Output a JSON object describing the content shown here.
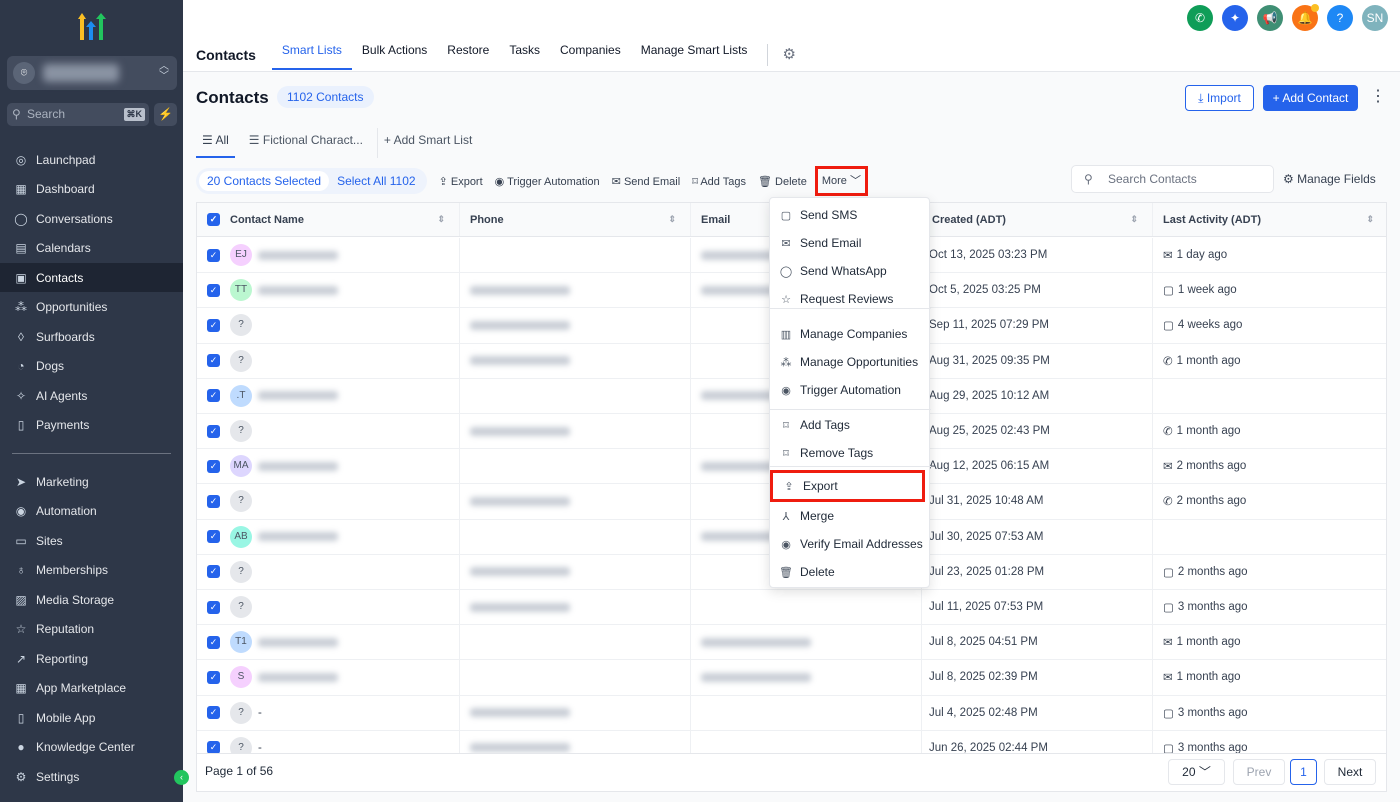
{
  "sidebar": {
    "search_placeholder": "Search",
    "shortcut": "⌘K",
    "items": [
      {
        "label": "Launchpad",
        "icon": "rocket-icon",
        "g": "◎"
      },
      {
        "label": "Dashboard",
        "icon": "dashboard-icon",
        "g": "▦"
      },
      {
        "label": "Conversations",
        "icon": "chat-icon",
        "g": "◯"
      },
      {
        "label": "Calendars",
        "icon": "calendar-icon",
        "g": "▤"
      },
      {
        "label": "Contacts",
        "icon": "contacts-icon",
        "g": "▣"
      },
      {
        "label": "Opportunities",
        "icon": "opportunities-icon",
        "g": "⁂"
      },
      {
        "label": "Surfboards",
        "icon": "surfboard-icon",
        "g": "◊"
      },
      {
        "label": "Dogs",
        "icon": "dog-icon",
        "g": "◔"
      },
      {
        "label": "AI Agents",
        "icon": "sparkle-icon",
        "g": "✧"
      },
      {
        "label": "Payments",
        "icon": "receipt-icon",
        "g": "▯"
      }
    ],
    "items2": [
      {
        "label": "Marketing",
        "icon": "send-icon",
        "g": "➤"
      },
      {
        "label": "Automation",
        "icon": "automation-icon",
        "g": "◉"
      },
      {
        "label": "Sites",
        "icon": "sites-icon",
        "g": "▭"
      },
      {
        "label": "Memberships",
        "icon": "membership-icon",
        "g": "♁"
      },
      {
        "label": "Media Storage",
        "icon": "image-icon",
        "g": "▨"
      },
      {
        "label": "Reputation",
        "icon": "star-icon",
        "g": "☆"
      },
      {
        "label": "Reporting",
        "icon": "chart-icon",
        "g": "↗"
      },
      {
        "label": "App Marketplace",
        "icon": "apps-icon",
        "g": "▦"
      },
      {
        "label": "Mobile App",
        "icon": "mobile-icon",
        "g": "▯"
      },
      {
        "label": "Knowledge Center",
        "icon": "book-icon",
        "g": "●"
      }
    ],
    "settings": "Settings"
  },
  "header": {
    "section": "Contacts",
    "tabs": [
      "Smart Lists",
      "Bulk Actions",
      "Restore",
      "Tasks",
      "Companies",
      "Manage Smart Lists"
    ],
    "avatar": "SN"
  },
  "page": {
    "title": "Contacts",
    "count": "1102 Contacts",
    "import": "Import",
    "add": "Add Contact"
  },
  "smart_lists": {
    "all": "All",
    "fictional": "Fictional Charact...",
    "add": "Add Smart List"
  },
  "bulk": {
    "selected": "20 Contacts Selected",
    "select_all": "Select All 1102",
    "export": "Export",
    "trigger": "Trigger Automation",
    "email": "Send Email",
    "tags": "Add Tags",
    "delete": "Delete",
    "more": "More"
  },
  "search": {
    "placeholder": "Search Contacts"
  },
  "manage_fields": "Manage Fields",
  "columns": [
    "Contact Name",
    "Phone",
    "Email",
    "Created (ADT)",
    "Last Activity (ADT)"
  ],
  "rows": [
    {
      "i": "EJ",
      "c": "#f5d0fe",
      "n": 1,
      "p": 0,
      "e": 1,
      "d": "Oct 13, 2025 03:23 PM",
      "ai": "✉",
      "a": "1 day ago"
    },
    {
      "i": "TT",
      "c": "#bbf7d0",
      "n": 1,
      "p": 1,
      "e": 1,
      "d": "Oct 5, 2025 03:25 PM",
      "ai": "▢",
      "a": "1 week ago"
    },
    {
      "i": "?",
      "c": "#e5e7eb",
      "n": 0,
      "p": 1,
      "e": 0,
      "d": "Sep 11, 2025 07:29 PM",
      "ai": "▢",
      "a": "4 weeks ago"
    },
    {
      "i": "?",
      "c": "#e5e7eb",
      "n": 0,
      "p": 1,
      "e": 0,
      "d": "Aug 31, 2025 09:35 PM",
      "ai": "✆",
      "a": "1 month ago"
    },
    {
      "i": ".T",
      "c": "#bfdbfe",
      "n": 1,
      "p": 0,
      "e": 1,
      "d": "Aug 29, 2025 10:12 AM",
      "ai": "",
      "a": ""
    },
    {
      "i": "?",
      "c": "#e5e7eb",
      "n": 0,
      "p": 1,
      "e": 0,
      "d": "Aug 25, 2025 02:43 PM",
      "ai": "✆",
      "a": "1 month ago"
    },
    {
      "i": "MA",
      "c": "#ddd6fe",
      "n": 1,
      "p": 0,
      "e": 1,
      "d": "Aug 12, 2025 06:15 AM",
      "ai": "✉",
      "a": "2 months ago"
    },
    {
      "i": "?",
      "c": "#e5e7eb",
      "n": 0,
      "p": 1,
      "e": 0,
      "d": "Jul 31, 2025 10:48 AM",
      "ai": "✆",
      "a": "2 months ago"
    },
    {
      "i": "AB",
      "c": "#99f6e4",
      "n": 1,
      "p": 0,
      "e": 1,
      "d": "Jul 30, 2025 07:53 AM",
      "ai": "",
      "a": ""
    },
    {
      "i": "?",
      "c": "#e5e7eb",
      "n": 0,
      "p": 1,
      "e": 0,
      "d": "Jul 23, 2025 01:28 PM",
      "ai": "▢",
      "a": "2 months ago"
    },
    {
      "i": "?",
      "c": "#e5e7eb",
      "n": 0,
      "p": 1,
      "e": 0,
      "d": "Jul 11, 2025 07:53 PM",
      "ai": "▢",
      "a": "3 months ago"
    },
    {
      "i": "T1",
      "c": "#bfdbfe",
      "n": 1,
      "p": 0,
      "e": 1,
      "d": "Jul 8, 2025 04:51 PM",
      "ai": "✉",
      "a": "1 month ago"
    },
    {
      "i": "S",
      "c": "#f5d0fe",
      "n": 1,
      "p": 0,
      "e": 1,
      "d": "Jul 8, 2025 02:39 PM",
      "ai": "✉",
      "a": "1 month ago"
    },
    {
      "i": "?",
      "c": "#e5e7eb",
      "n": 0,
      "p": 1,
      "e": 0,
      "d": "Jul 4, 2025 02:48 PM",
      "ai": "▢",
      "a": "3 months ago",
      "t": "-"
    },
    {
      "i": "?",
      "c": "#e5e7eb",
      "n": 0,
      "p": 1,
      "e": 0,
      "d": "Jun 26, 2025 02:44 PM",
      "ai": "▢",
      "a": "3 months ago",
      "t": "-"
    }
  ],
  "menu": [
    {
      "label": "Send SMS",
      "g": "▢",
      "icon": "sms-icon"
    },
    {
      "label": "Send Email",
      "g": "✉",
      "icon": "mail-icon"
    },
    {
      "label": "Send WhatsApp",
      "g": "◯",
      "icon": "whatsapp-icon"
    },
    {
      "label": "Request Reviews",
      "g": "☆",
      "icon": "star-icon"
    },
    {
      "label": "Manage Companies",
      "g": "▥",
      "icon": "building-icon"
    },
    {
      "label": "Manage Opportunities",
      "g": "⁂",
      "icon": "opportunities-icon"
    },
    {
      "label": "Trigger Automation",
      "g": "◉",
      "icon": "automation-icon"
    },
    {
      "label": "Add Tags",
      "g": "⌑",
      "icon": "tag-icon"
    },
    {
      "label": "Remove Tags",
      "g": "⌑",
      "icon": "tag-remove-icon"
    },
    {
      "label": "Export",
      "g": "⇪",
      "icon": "export-icon"
    },
    {
      "label": "Merge",
      "g": "⅄",
      "icon": "merge-icon"
    },
    {
      "label": "Verify Email Addresses",
      "g": "◉",
      "icon": "eye-icon"
    },
    {
      "label": "Delete",
      "g": "🗑",
      "icon": "trash-icon"
    }
  ],
  "footer": {
    "page": "Page 1 of 56",
    "per_page": "20",
    "prev": "Prev",
    "current": "1",
    "next": "Next"
  }
}
